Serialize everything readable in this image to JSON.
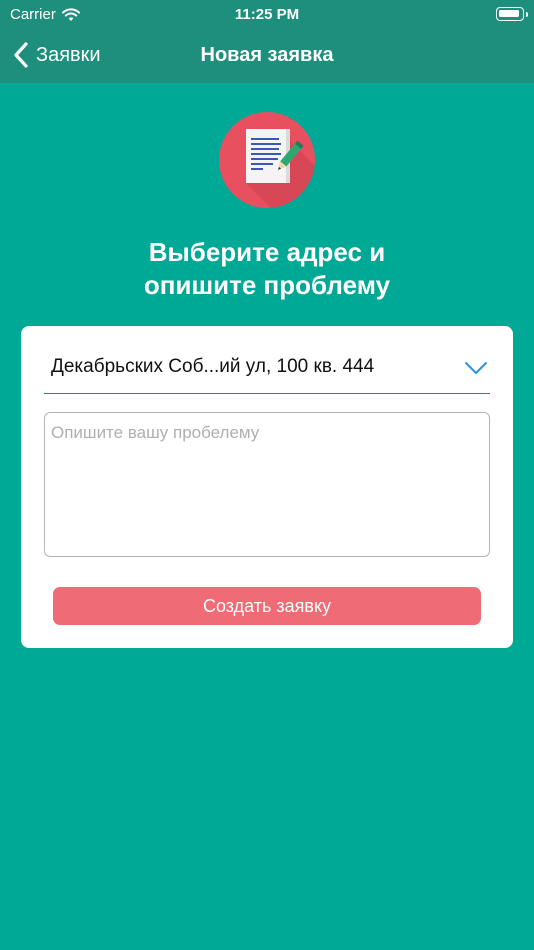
{
  "status_bar": {
    "carrier": "Carrier",
    "time": "11:25 PM",
    "icons": [
      "wifi-icon",
      "battery-icon"
    ]
  },
  "nav": {
    "back_label": "Заявки",
    "title": "Новая заявка",
    "back_icon": "chevron-left-icon"
  },
  "hero": {
    "icon": "document-pencil-icon",
    "headline_line1": "Выберите адрес и",
    "headline_line2": "опишите проблему"
  },
  "form": {
    "address_value": "Декабрьских Соб...ий ул, 100 кв. 444",
    "address_icon": "chevron-down-icon",
    "description_placeholder": "Опишите вашу пробелему",
    "description_value": "",
    "submit_label": "Создать заявку"
  },
  "colors": {
    "background": "#00A896",
    "bar": "#1F8F7D",
    "accent": "#2F8FE0",
    "button": "#EF6B76",
    "icon_circle": "#E9505F"
  }
}
